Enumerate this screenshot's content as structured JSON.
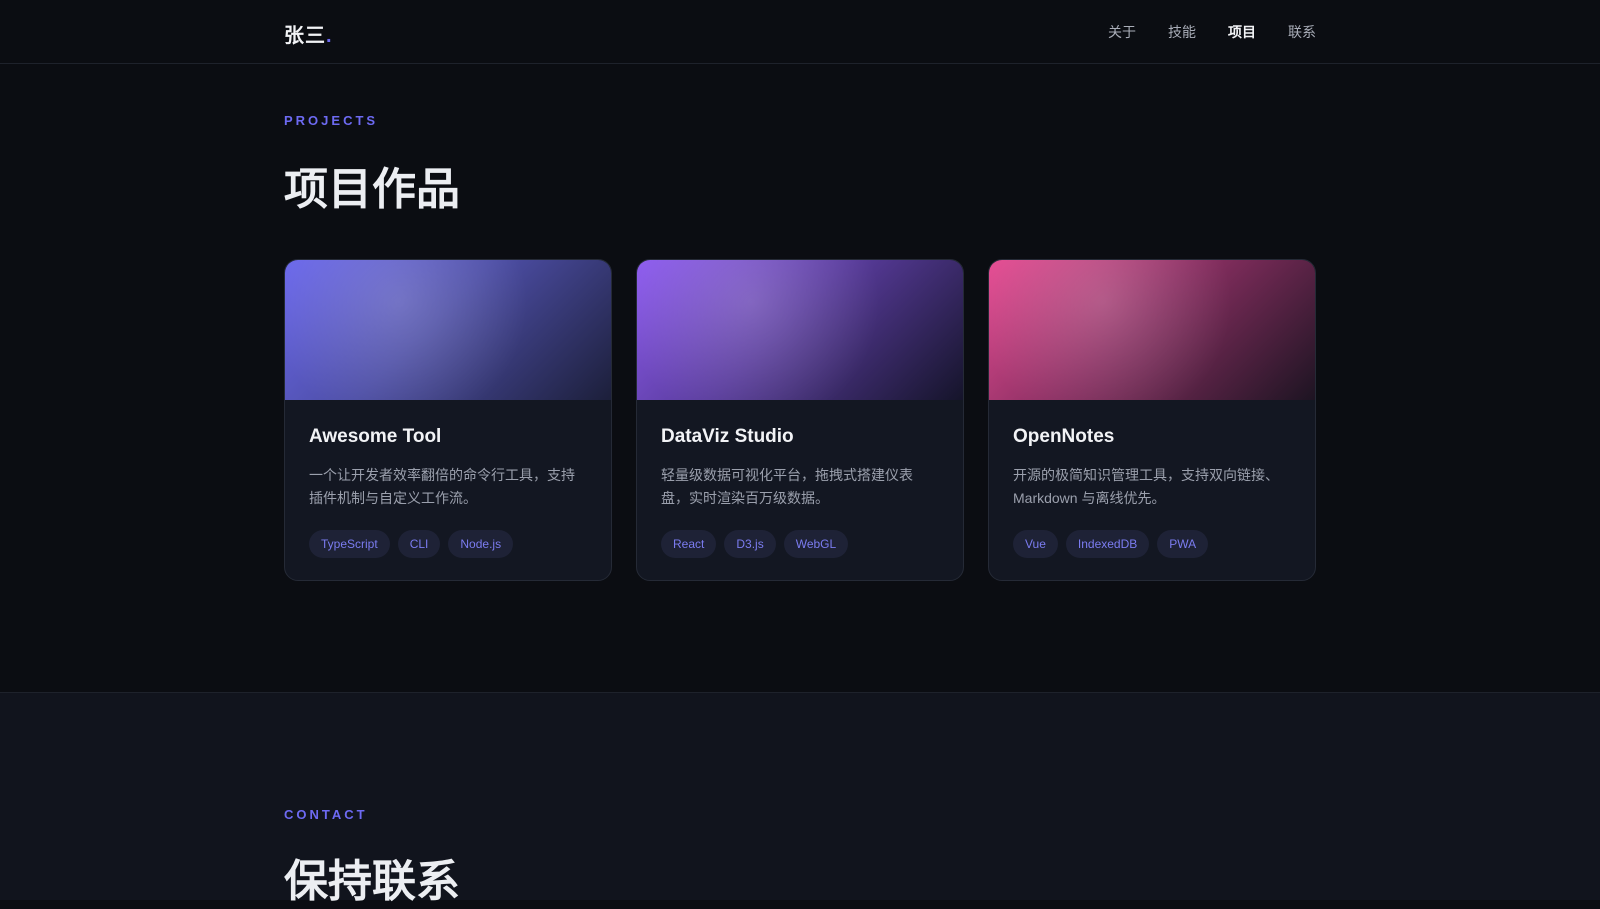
{
  "header": {
    "logo_text": "张三",
    "logo_dot": ".",
    "nav": [
      {
        "label": "关于"
      },
      {
        "label": "技能"
      },
      {
        "label": "项目"
      },
      {
        "label": "联系"
      }
    ]
  },
  "projects": {
    "eyebrow": "PROJECTS",
    "title": "项目作品",
    "cards": [
      {
        "title": "Awesome Tool",
        "description": "一个让开发者效率翻倍的命令行工具，支持插件机制与自定义工作流。",
        "tags": [
          "TypeScript",
          "CLI",
          "Node.js"
        ]
      },
      {
        "title": "DataViz Studio",
        "description": "轻量级数据可视化平台，拖拽式搭建仪表盘，实时渲染百万级数据。",
        "tags": [
          "React",
          "D3.js",
          "WebGL"
        ]
      },
      {
        "title": "OpenNotes",
        "description": "开源的极简知识管理工具，支持双向链接、Markdown 与离线优先。",
        "tags": [
          "Vue",
          "IndexedDB",
          "PWA"
        ]
      }
    ]
  },
  "contact": {
    "eyebrow": "CONTACT",
    "title": "保持联系"
  },
  "colors": {
    "accent": "#6d6af2",
    "background": "#0b0d12",
    "card_background": "#131722"
  }
}
